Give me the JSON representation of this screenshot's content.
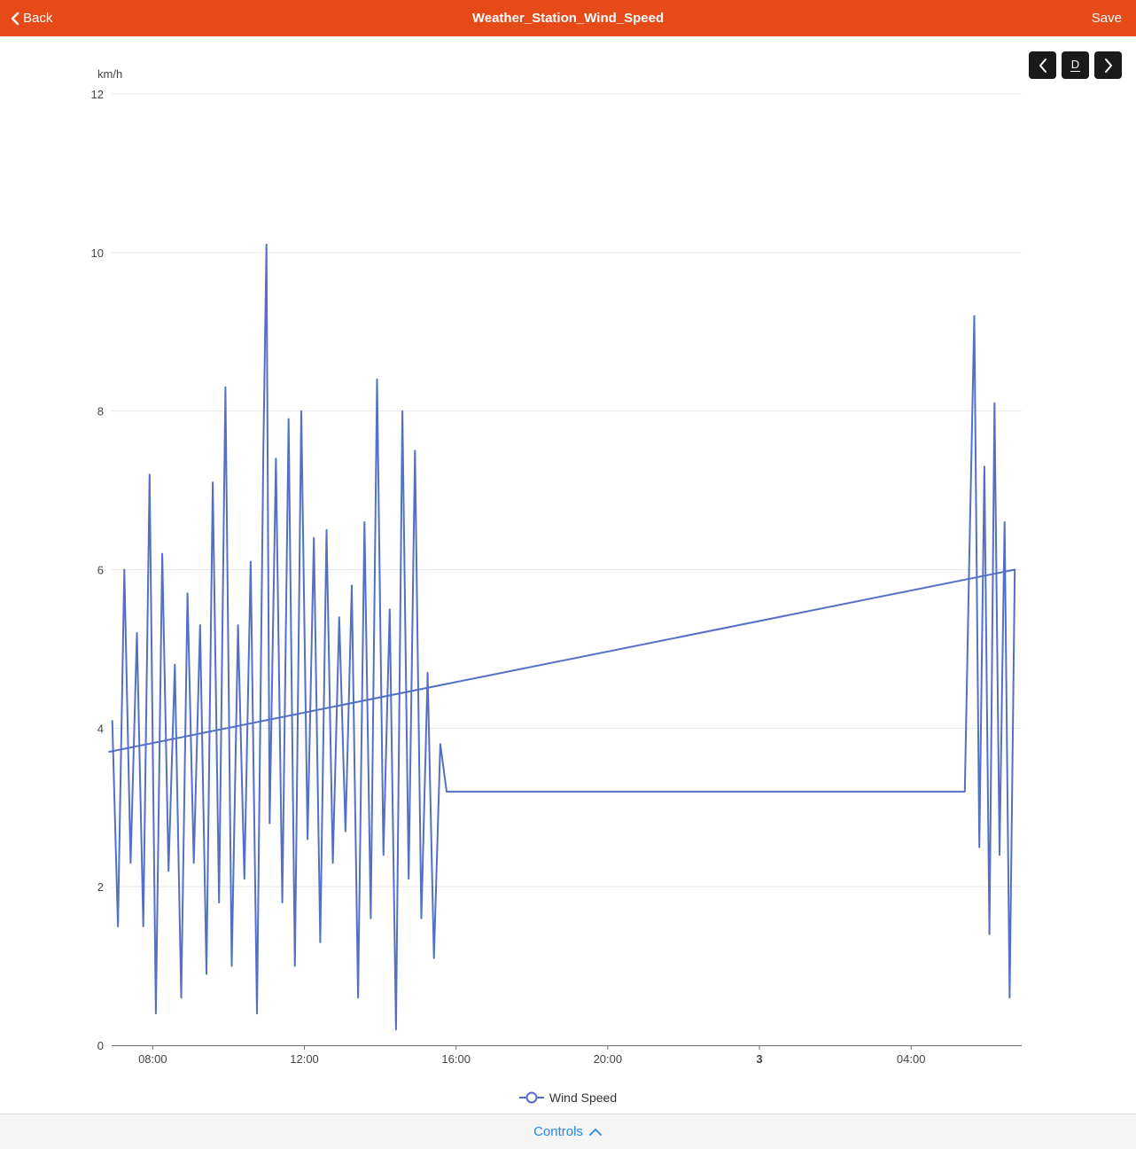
{
  "header": {
    "back_label": "Back",
    "title": "Weather_Station_Wind_Speed",
    "save_label": "Save",
    "bg_color": "#e64a19"
  },
  "toolbar": {
    "prev_icon": "chevron-left-icon",
    "range_label": "D",
    "next_icon": "chevron-right-icon"
  },
  "footer": {
    "controls_label": "Controls",
    "controls_icon": "chevron-up-icon"
  },
  "chart_data": {
    "type": "line",
    "title": "",
    "xlabel": "",
    "ylabel": "km/h",
    "ylim": [
      0,
      12
    ],
    "yticks": [
      0,
      2,
      4,
      6,
      8,
      10,
      12
    ],
    "xlim": [
      "2-Day1 06:55",
      "Day2 06:55"
    ],
    "xticks": [
      {
        "label": "08:00",
        "bold": false
      },
      {
        "label": "12:00",
        "bold": false
      },
      {
        "label": "16:00",
        "bold": false
      },
      {
        "label": "20:00",
        "bold": false
      },
      {
        "label": "3",
        "bold": true
      },
      {
        "label": "04:00",
        "bold": false
      }
    ],
    "grid": true,
    "legend_position": "bottom-center",
    "line_color": "#5470c6",
    "series": [
      {
        "name": "Wind Speed",
        "x": [
          "06:56",
          "07:05",
          "07:15",
          "07:25",
          "07:35",
          "07:45",
          "07:55",
          "08:05",
          "08:15",
          "08:25",
          "08:35",
          "08:45",
          "08:55",
          "09:05",
          "09:15",
          "09:25",
          "09:35",
          "09:45",
          "09:55",
          "10:05",
          "10:15",
          "10:25",
          "10:35",
          "10:45",
          "10:55",
          "11:00",
          "11:05",
          "11:15",
          "11:25",
          "11:35",
          "11:45",
          "11:55",
          "12:05",
          "12:15",
          "12:25",
          "12:35",
          "12:45",
          "12:55",
          "13:05",
          "13:15",
          "13:25",
          "13:35",
          "13:45",
          "13:55",
          "14:05",
          "14:15",
          "14:25",
          "14:35",
          "14:45",
          "14:55",
          "15:05",
          "15:15",
          "15:25",
          "15:35",
          "15:45",
          "05:25",
          "05:32",
          "05:40",
          "05:48",
          "05:56",
          "06:04",
          "06:12",
          "06:20",
          "06:28",
          "06:36",
          "06:44",
          "06:50"
        ],
        "y": [
          4.1,
          1.5,
          6.0,
          2.3,
          5.2,
          1.5,
          7.2,
          0.4,
          6.2,
          2.2,
          4.8,
          0.6,
          5.7,
          2.3,
          5.3,
          0.9,
          7.1,
          1.8,
          8.3,
          1.0,
          5.3,
          2.1,
          6.1,
          0.4,
          7.5,
          10.1,
          2.8,
          7.4,
          1.8,
          7.9,
          1.0,
          8.0,
          2.6,
          6.4,
          1.3,
          6.5,
          2.3,
          5.4,
          2.7,
          5.8,
          0.6,
          6.6,
          1.6,
          8.4,
          2.4,
          5.5,
          0.2,
          8.0,
          2.1,
          7.5,
          1.6,
          4.7,
          1.1,
          3.8,
          3.2,
          3.2,
          6.1,
          9.2,
          2.5,
          7.3,
          1.4,
          8.1,
          2.4,
          6.6,
          0.6,
          6.0,
          3.7
        ]
      }
    ]
  }
}
